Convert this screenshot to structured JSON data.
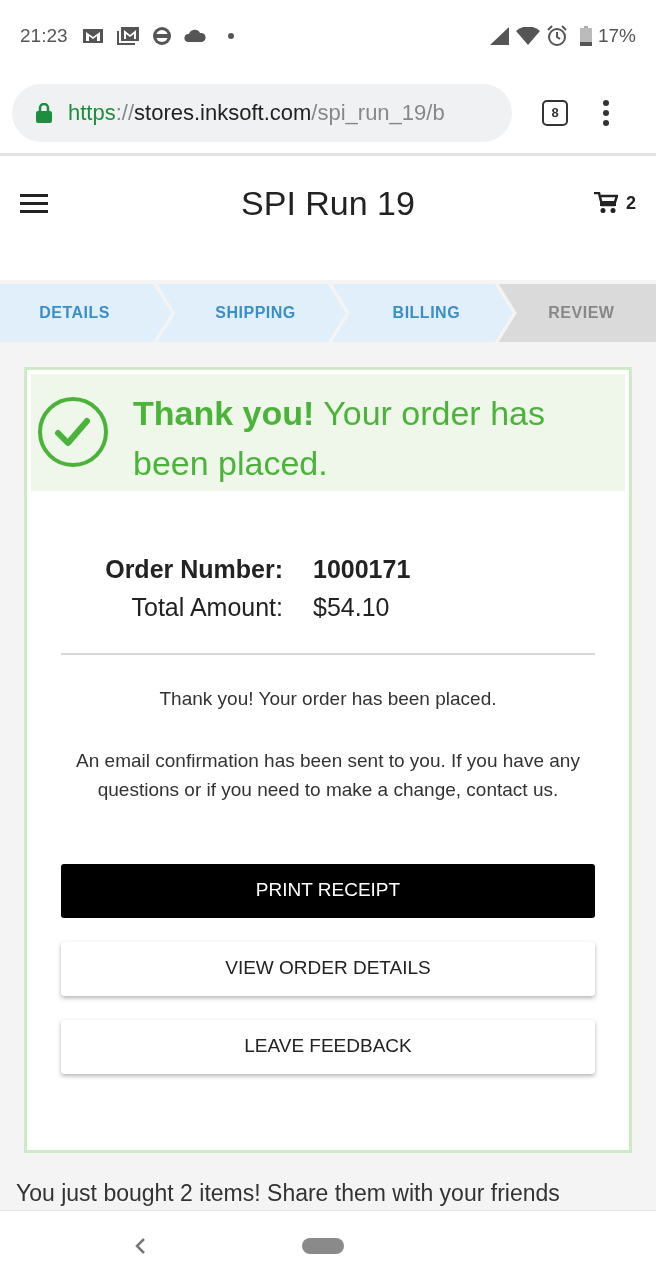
{
  "status_bar": {
    "time": "21:23",
    "battery": "17%"
  },
  "browser": {
    "url": {
      "scheme": "https",
      "separator": "://",
      "host": "stores.inksoft.com",
      "path": "/spi_run_19/b"
    },
    "tab_count": "8"
  },
  "header": {
    "title": "SPI Run 19",
    "cart_count": "2"
  },
  "steps": [
    {
      "label": "DETAILS",
      "completed": true
    },
    {
      "label": "SHIPPING",
      "completed": true
    },
    {
      "label": "BILLING",
      "completed": true
    },
    {
      "label": "REVIEW",
      "completed": false
    }
  ],
  "confirmation": {
    "heading": "**Thank you!** Your order has been placed.",
    "summary": [
      {
        "label": "Order Number:",
        "value": "1000171",
        "kind": "bold"
      },
      {
        "label": "Total Amount:",
        "value": "$54.10",
        "kind": "plain"
      }
    ],
    "message": "Thank you! Your order has been placed.",
    "note": "An email confirmation has been sent to you. If you have any questions or if you need to make a change, contact us.",
    "buttons": [
      {
        "label": "PRINT RECEIPT",
        "kind": "primary"
      },
      {
        "label": "VIEW ORDER DETAILS",
        "kind": "secondary"
      },
      {
        "label": "LEAVE FEEDBACK",
        "kind": "secondary"
      }
    ]
  },
  "share_text": "You just bought 2 items! Share them with your friends"
}
